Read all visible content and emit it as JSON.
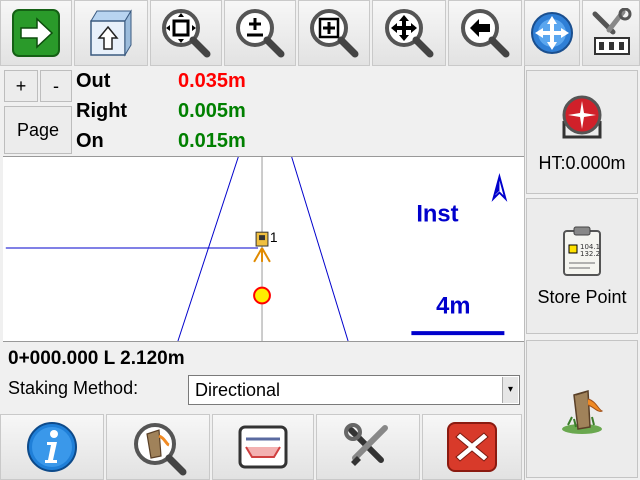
{
  "toolbar": {
    "icons": [
      "next-arrow-icon",
      "upload-icon",
      "zoom-extents-icon",
      "zoom-in-out-icon",
      "zoom-window-icon",
      "pan-icon",
      "zoom-previous-icon",
      "compass-icon",
      "tools-icon"
    ]
  },
  "page_controls": {
    "plus": "+",
    "minus": "-",
    "page": "Page"
  },
  "readouts": [
    {
      "label": "Out",
      "value": "0.035m",
      "color": "#ff0000"
    },
    {
      "label": "Right",
      "value": "0.005m",
      "color": "#008000"
    },
    {
      "label": "On",
      "value": "0.015m",
      "color": "#008000"
    }
  ],
  "side": {
    "ht_label": "HT:0.000m",
    "store_label": "Store Point",
    "store_icon_lines": [
      "104.1",
      "132.2"
    ]
  },
  "map": {
    "inst_label": "Inst",
    "scale_label": "4m",
    "point_label": "1",
    "colors": {
      "lines": "#0000cc",
      "target": "#ff0000",
      "target_fill": "#ffee00"
    }
  },
  "station": {
    "text": "0+000.000 L 2.120m"
  },
  "staking": {
    "label": "Staking Method:",
    "value": "Directional"
  },
  "bottom_toolbar": {
    "icons": [
      "info-icon",
      "stake-search-icon",
      "road-cross-section-icon",
      "settings-tools-icon",
      "close-icon"
    ]
  }
}
